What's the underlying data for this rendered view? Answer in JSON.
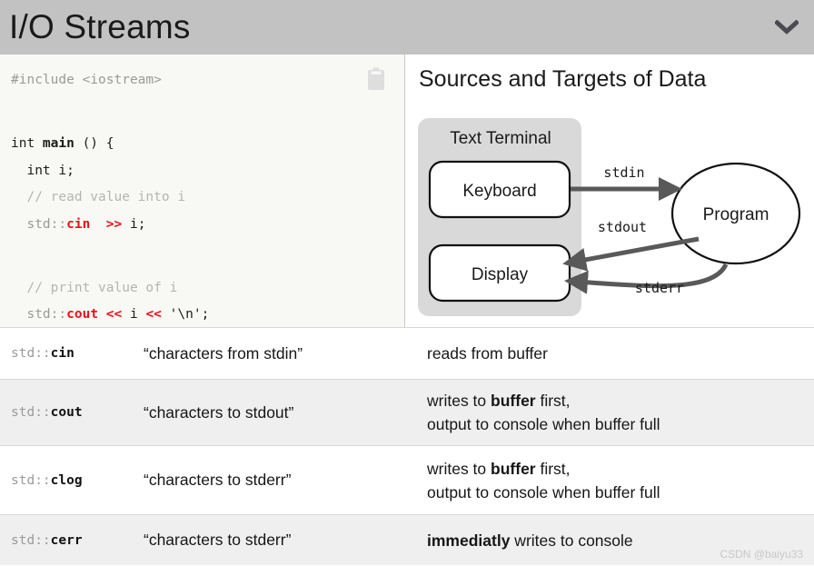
{
  "header": {
    "title": "I/O Streams",
    "collapse_icon": "chevron-down-icon"
  },
  "code_panel": {
    "copy_icon": "clipboard-copy-icon",
    "lines": [
      {
        "type": "include",
        "text": "#include <iostream>"
      },
      {
        "type": "blank",
        "text": ""
      },
      {
        "type": "signature",
        "pre": "int ",
        "bold": "main",
        "post": " () {"
      },
      {
        "type": "plain",
        "text": "  int i;"
      },
      {
        "type": "comment",
        "text": "  // read value into i"
      },
      {
        "type": "stream",
        "indent": "  ",
        "ns": "std::",
        "stream": "cin",
        "op": "  >>",
        "rest": " i;"
      },
      {
        "type": "blank",
        "text": ""
      },
      {
        "type": "comment",
        "text": "  // print value of i"
      },
      {
        "type": "stream2",
        "indent": "  ",
        "ns": "std::",
        "stream": "cout",
        "op": " <<",
        "mid": " i ",
        "op2": "<<",
        "rest": " '\\n';"
      },
      {
        "type": "plain",
        "text": "}"
      }
    ]
  },
  "diagram": {
    "title": "Sources and Targets of Data",
    "terminal_label": "Text Terminal",
    "keyboard_label": "Keyboard",
    "display_label": "Display",
    "program_label": "Program",
    "arrows": [
      {
        "name": "stdin",
        "label": "stdin",
        "from": "Keyboard",
        "to": "Program"
      },
      {
        "name": "stdout",
        "label": "stdout",
        "from": "Program",
        "to": "Display"
      },
      {
        "name": "stderr",
        "label": "stderr",
        "from": "Program",
        "to": "Display"
      }
    ],
    "colors": {
      "terminal_fill": "#d9d9d9",
      "arrow": "#595959",
      "box_stroke": "#111111"
    }
  },
  "table": {
    "rows": [
      {
        "ns": "std::",
        "stream": "cin",
        "description": "“characters from stdin”",
        "note_line1_pre": "reads from buffer",
        "note_bold": "",
        "note_line1_post": "",
        "note_line2": ""
      },
      {
        "ns": "std::",
        "stream": "cout",
        "description": "“characters to stdout”",
        "note_line1_pre": "writes to ",
        "note_bold": "buffer",
        "note_line1_post": " first,",
        "note_line2": "output to console when buffer full"
      },
      {
        "ns": "std::",
        "stream": "clog",
        "description": "“characters to stderr”",
        "note_line1_pre": "writes to ",
        "note_bold": "buffer",
        "note_line1_post": " first,",
        "note_line2": "output to console when buffer full"
      },
      {
        "ns": "std::",
        "stream": "cerr",
        "description": "“characters to stderr”",
        "note_line1_pre": "",
        "note_bold": "immediatly",
        "note_line1_post": " writes to console",
        "note_line2": ""
      }
    ]
  },
  "watermark": "CSDN @baiyu33"
}
